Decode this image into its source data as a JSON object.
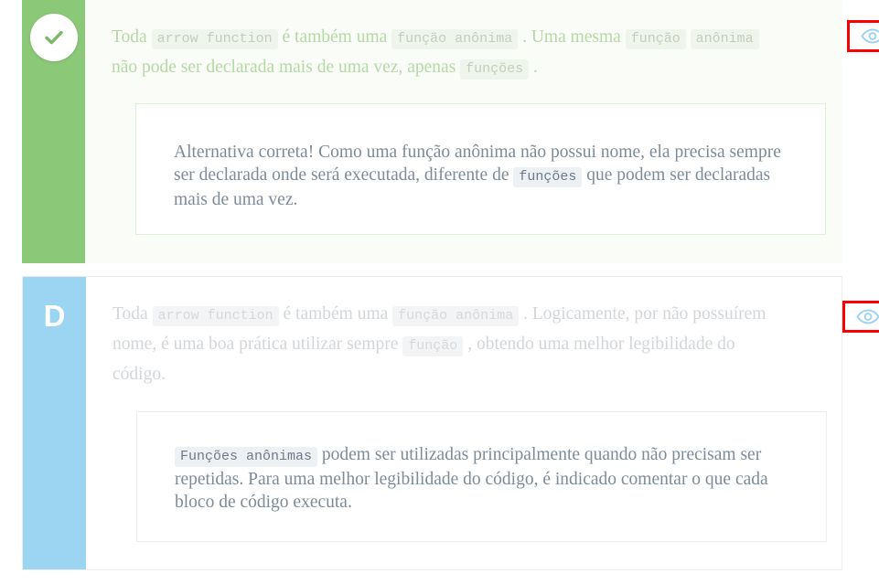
{
  "options": [
    {
      "id": "option-correct",
      "letter": "",
      "is_correct": true,
      "rail_color": "#8bc878",
      "card_bg": "#fafcf8",
      "icon": "check-circle-icon",
      "statement_parts": [
        {
          "type": "text",
          "value": "Toda"
        },
        {
          "type": "code",
          "value": "arrow function"
        },
        {
          "type": "text",
          "value": "é também uma"
        },
        {
          "type": "code",
          "value": "função anônima"
        },
        {
          "type": "text",
          "value": ". Uma mesma"
        },
        {
          "type": "code",
          "value": "função"
        },
        {
          "type": "text",
          "value": "anônima"
        },
        {
          "type": "text",
          "value": "não pode ser declarada mais de uma vez, apenas"
        },
        {
          "type": "code",
          "value": "funções"
        },
        {
          "type": "text",
          "value": "."
        }
      ],
      "feedback_parts": [
        {
          "type": "text",
          "value": "Alternativa correta! Como uma função anônima não possui nome, ela precisa sempre ser declarada onde será executada, diferente de"
        },
        {
          "type": "code",
          "value": "funções"
        },
        {
          "type": "text",
          "value": "que podem ser declaradas mais de uma vez."
        }
      ],
      "eye_button": {
        "name": "toggle-feedback-visibility",
        "icon": "eye-icon",
        "icon_color": "#9ed4f2",
        "highlight_color": "#fb0000"
      }
    },
    {
      "id": "option-d",
      "letter": "D",
      "is_correct": false,
      "rail_color": "#9bd5f2",
      "card_bg": "#ffffff",
      "icon": "",
      "statement_parts": [
        {
          "type": "text",
          "value": "Toda"
        },
        {
          "type": "code",
          "value": "arrow function"
        },
        {
          "type": "text",
          "value": "é também uma"
        },
        {
          "type": "code",
          "value": "função anônima"
        },
        {
          "type": "text",
          "value": ". Logicamente, por não possuírem nome, é uma boa prática utilizar sempre"
        },
        {
          "type": "code",
          "value": "função"
        },
        {
          "type": "text",
          "value": ", obtendo uma melhor legibilidade do código."
        }
      ],
      "feedback_parts": [
        {
          "type": "code",
          "value": "Funções anônimas"
        },
        {
          "type": "text",
          "value": "podem ser utilizadas principalmente quando não precisam ser repetidas. Para uma melhor legibilidade do código, é indicado comentar o que cada bloco de código executa."
        }
      ],
      "eye_button": {
        "name": "toggle-feedback-visibility",
        "icon": "eye-icon",
        "icon_color": "#9ed4f2",
        "highlight_color": "#fb0000"
      }
    }
  ],
  "colors": {
    "correct_green": "#8bc878",
    "option_blue": "#9bd5f2",
    "muted_green_text": "#b4d9a4",
    "muted_grey_text": "#d2d6d9",
    "feedback_text": "#7d8b99",
    "annotation_red": "#fb0000"
  }
}
